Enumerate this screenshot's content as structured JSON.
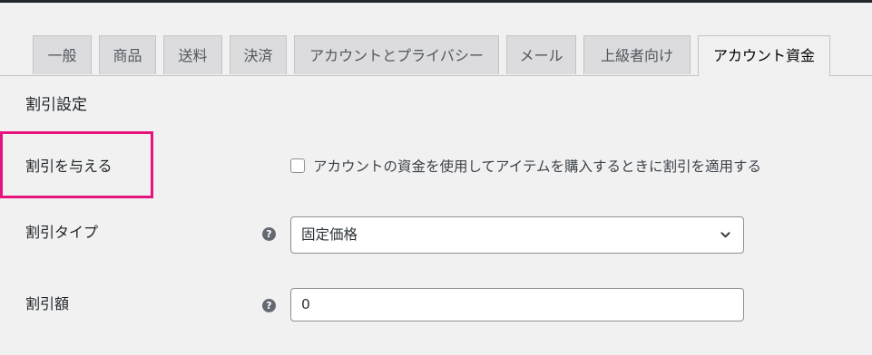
{
  "tabs": [
    {
      "label": "一般",
      "active": false
    },
    {
      "label": "商品",
      "active": false
    },
    {
      "label": "送料",
      "active": false
    },
    {
      "label": "決済",
      "active": false
    },
    {
      "label": "アカウントとプライバシー",
      "active": false
    },
    {
      "label": "メール",
      "active": false
    },
    {
      "label": "上級者向け",
      "active": false
    },
    {
      "label": "アカウント資金",
      "active": true
    }
  ],
  "section_title": "割引設定",
  "fields": {
    "give_discount": {
      "label": "割引を与える",
      "checkbox_label": "アカウントの資金を使用してアイテムを購入するときに割引を適用する",
      "checked": false
    },
    "discount_type": {
      "label": "割引タイプ",
      "help_icon": "?",
      "selected_value": "固定価格"
    },
    "discount_amount": {
      "label": "割引額",
      "help_icon": "?",
      "value": "0"
    }
  },
  "colors": {
    "highlight": "#e4137d",
    "background": "#f1f1f1",
    "tab_inactive": "#dcdcde"
  }
}
